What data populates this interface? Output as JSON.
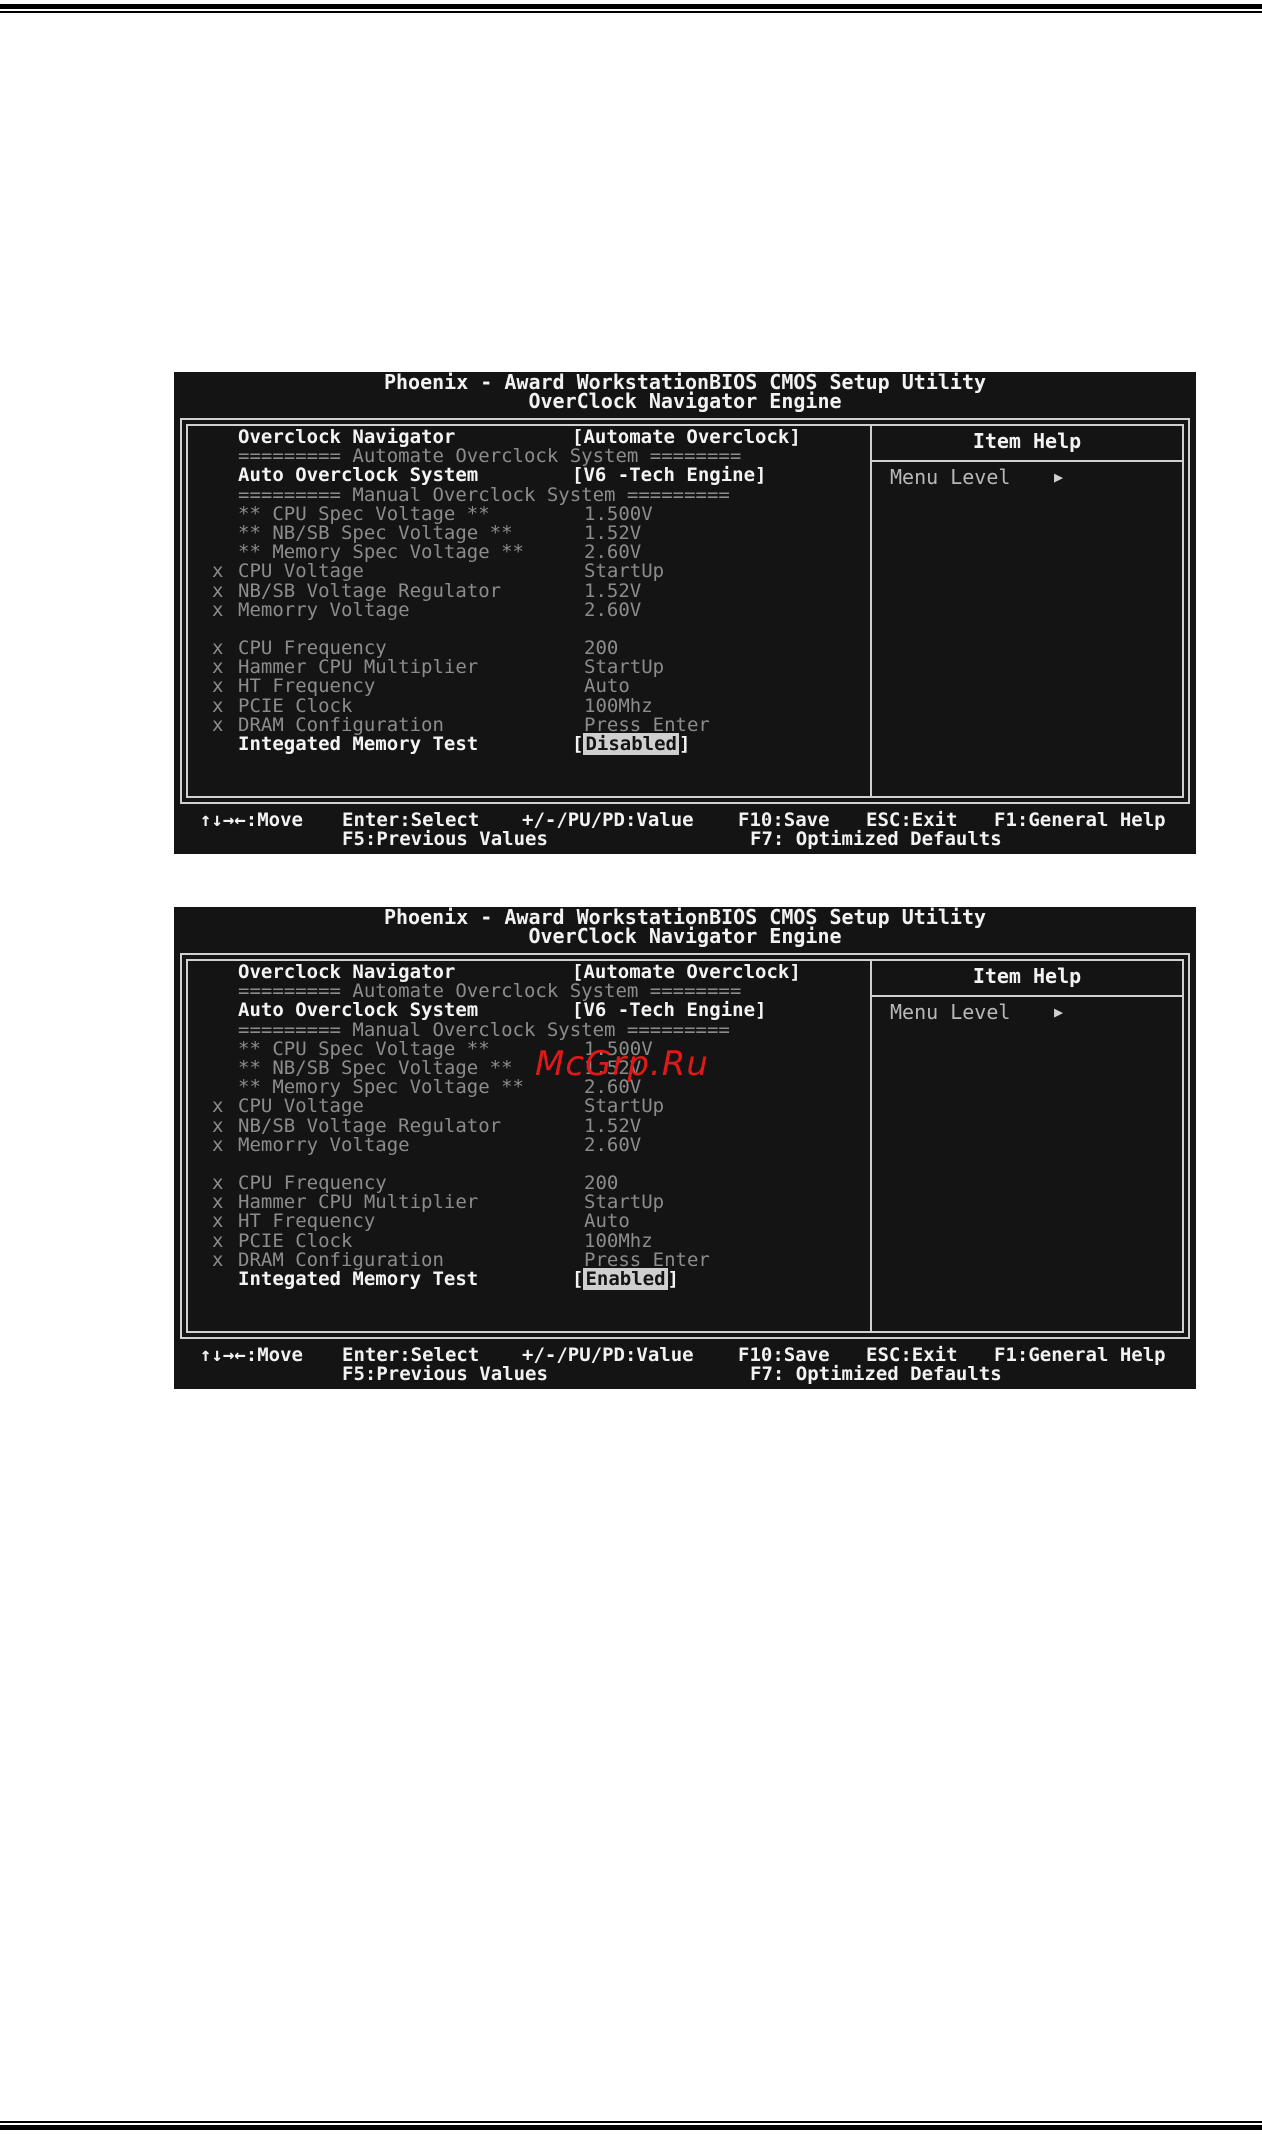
{
  "bios_title": "Phoenix - Award WorkstationBIOS CMOS Setup Utility",
  "bios_subtitle": "OverClock Navigator Engine",
  "help": {
    "title": "Item Help",
    "menu_level": "Menu Level",
    "arrow": "▶"
  },
  "footer": {
    "move": "↑↓→←:Move",
    "select": "Enter:Select",
    "value": "+/-/PU/PD:Value",
    "save": "F10:Save",
    "exit": "ESC:Exit",
    "general_help": "F1:General Help",
    "previous": "F5:Previous Values",
    "defaults": "F7: Optimized Defaults"
  },
  "rows": {
    "overclock_navigator": {
      "label": "Overclock Navigator",
      "value": "[Automate Overclock]"
    },
    "sep_automate": "========= Automate Overclock System ========",
    "auto_overclock_system": {
      "label": "Auto Overclock System",
      "value": "[V6 -Tech Engine]"
    },
    "sep_manual": "========= Manual Overclock System =========",
    "cpu_spec_voltage": {
      "label": "** CPU Spec Voltage **",
      "value": "1.500V"
    },
    "nbsb_spec_voltage": {
      "label": "** NB/SB Spec Voltage **",
      "value": "1.52V"
    },
    "memory_spec_voltage": {
      "label": "** Memory Spec Voltage **",
      "value": "2.60V"
    },
    "cpu_voltage": {
      "mark": "x",
      "label": "CPU Voltage",
      "value": "StartUp"
    },
    "nbsb_voltage_regulator": {
      "mark": "x",
      "label": "NB/SB Voltage Regulator",
      "value": "1.52V"
    },
    "memory_voltage": {
      "mark": "x",
      "label": "Memorry Voltage",
      "value": "2.60V"
    },
    "cpu_frequency": {
      "mark": "x",
      "label": "CPU Frequency",
      "value": "200"
    },
    "hammer_cpu_multiplier": {
      "mark": "x",
      "label": "Hammer CPU Multiplier",
      "value": "StartUp"
    },
    "ht_frequency": {
      "mark": "x",
      "label": "HT Frequency",
      "value": "Auto"
    },
    "pcie_clock": {
      "mark": "x",
      "label": "PCIE Clock",
      "value": "100Mhz"
    },
    "dram_configuration": {
      "mark": "x",
      "label": "DRAM Configuration",
      "value": "Press Enter"
    },
    "memory_test_label": "Integated Memory Test"
  },
  "screens": [
    {
      "memory_test_value": "Disabled"
    },
    {
      "memory_test_value": "Enabled"
    }
  ],
  "watermark": "McGrp.Ru"
}
